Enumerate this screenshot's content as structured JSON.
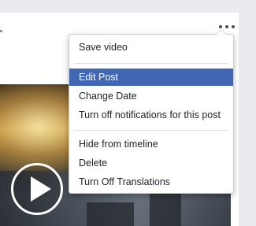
{
  "post_menu": {
    "items": [
      "Save video",
      "Edit Post",
      "Change Date",
      "Turn off notifications for this post",
      "Hide from timeline",
      "Delete",
      "Turn Off Translations"
    ]
  },
  "colors": {
    "highlight": "#4267b2",
    "background": "#e9ebee"
  },
  "icons": {
    "more": "more-horizontal-icon",
    "play": "play-icon"
  }
}
